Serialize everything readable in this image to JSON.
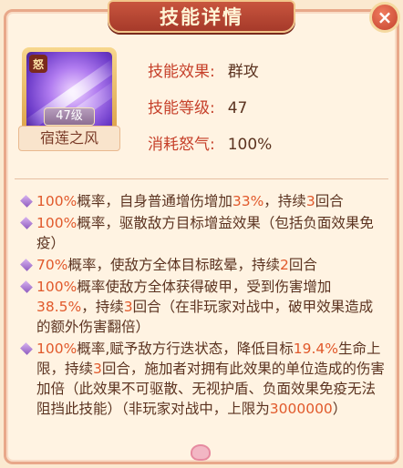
{
  "title": "技能详情",
  "close_icon": "×",
  "skill": {
    "fate_badge": "怒",
    "level_badge": "47级",
    "name": "宿莲之风",
    "rows": [
      {
        "label": "技能效果:",
        "value": "群攻"
      },
      {
        "label": "技能等级:",
        "value": "47"
      },
      {
        "label": "消耗怒气:",
        "value": "100%"
      }
    ]
  },
  "effects": [
    [
      {
        "t": "100%",
        "hl": true
      },
      {
        "t": "概率，自身普通增伤增加"
      },
      {
        "t": "33%",
        "hl": true
      },
      {
        "t": "，持续"
      },
      {
        "t": "3",
        "hl": true
      },
      {
        "t": "回合"
      }
    ],
    [
      {
        "t": "100%",
        "hl": true
      },
      {
        "t": "概率，驱散敌方目标增益效果（包括负面效果免疫）"
      }
    ],
    [
      {
        "t": "70%",
        "hl": true
      },
      {
        "t": "概率，使敌方全体目标眩晕，持续"
      },
      {
        "t": "2",
        "hl": true
      },
      {
        "t": "回合"
      }
    ],
    [
      {
        "t": "100%",
        "hl": true
      },
      {
        "t": "概率使敌方全体获得破甲，受到伤害增加"
      },
      {
        "t": "38.5%",
        "hl": true
      },
      {
        "t": "，持续"
      },
      {
        "t": "3",
        "hl": true
      },
      {
        "t": "回合（在非玩家对战中，破甲效果造成的额外伤害翻倍）"
      }
    ],
    [
      {
        "t": "100%",
        "hl": true
      },
      {
        "t": "概率,赋予敌方行迭状态，降低目标"
      },
      {
        "t": "19.4%",
        "hl": true
      },
      {
        "t": "生命上限，持续"
      },
      {
        "t": "3",
        "hl": true
      },
      {
        "t": "回合，施加者对拥有此效果的单位造成的伤害加倍（此效果不可驱散、无视护盾、负面效果免疫无法阻挡此技能）（非玩家对战中，上限为"
      },
      {
        "t": "3000000",
        "hl": true
      },
      {
        "t": "）"
      }
    ]
  ],
  "colors": {
    "highlight": "#e1592b",
    "label": "#c6402a",
    "header": "#b5432f"
  }
}
